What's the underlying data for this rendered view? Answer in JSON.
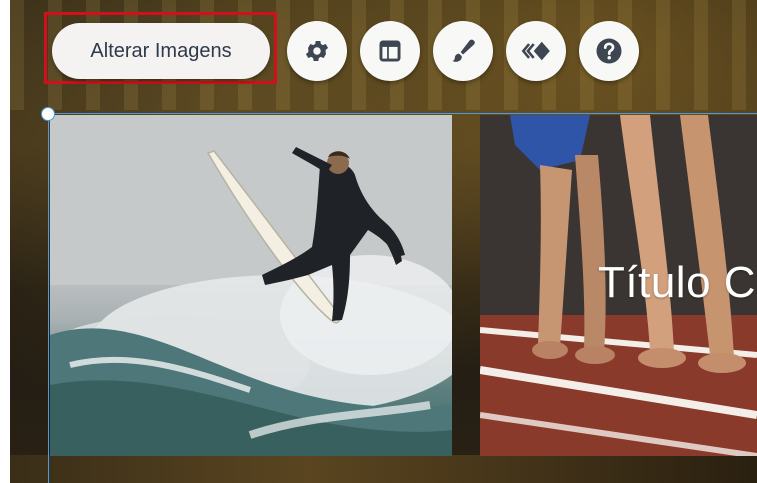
{
  "toolbar": {
    "change_images_label": "Alterar Imagens",
    "buttons": [
      {
        "icon": "gear-icon"
      },
      {
        "icon": "layout-icon"
      },
      {
        "icon": "brush-icon"
      },
      {
        "icon": "animation-icon"
      },
      {
        "icon": "help-icon"
      }
    ]
  },
  "slide": {
    "title": "Título C"
  },
  "colors": {
    "highlight": "#d0101a",
    "selection": "#4a9be4",
    "icon": "#3e4651"
  }
}
